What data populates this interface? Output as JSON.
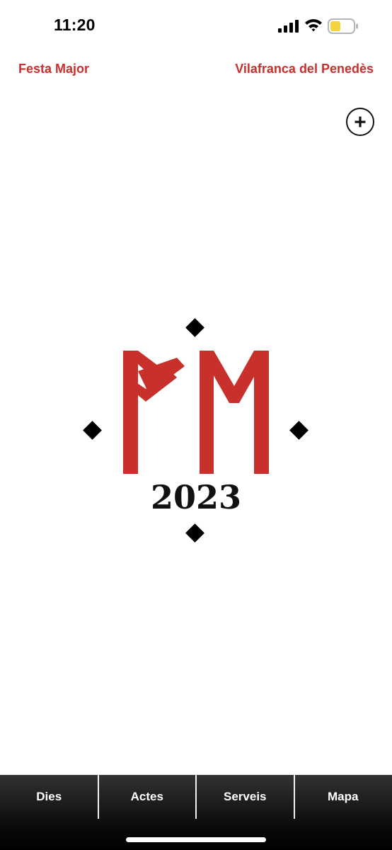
{
  "status_bar": {
    "time": "11:20",
    "icons": [
      "signal-icon",
      "wifi-icon",
      "battery-icon"
    ],
    "battery_level": 0.45,
    "battery_color": "#f5d33a"
  },
  "header": {
    "left_title": "Festa Major",
    "right_title": "Vilafranca del Penedès",
    "accent_color": "#c8302c",
    "add_icon": "plus-circle-icon"
  },
  "logo": {
    "year": "2023",
    "letters_color": "#c8302c",
    "diamond_color": "#000000"
  },
  "tabs": [
    {
      "label": "Dies"
    },
    {
      "label": "Actes"
    },
    {
      "label": "Serveis"
    },
    {
      "label": "Mapa"
    }
  ]
}
